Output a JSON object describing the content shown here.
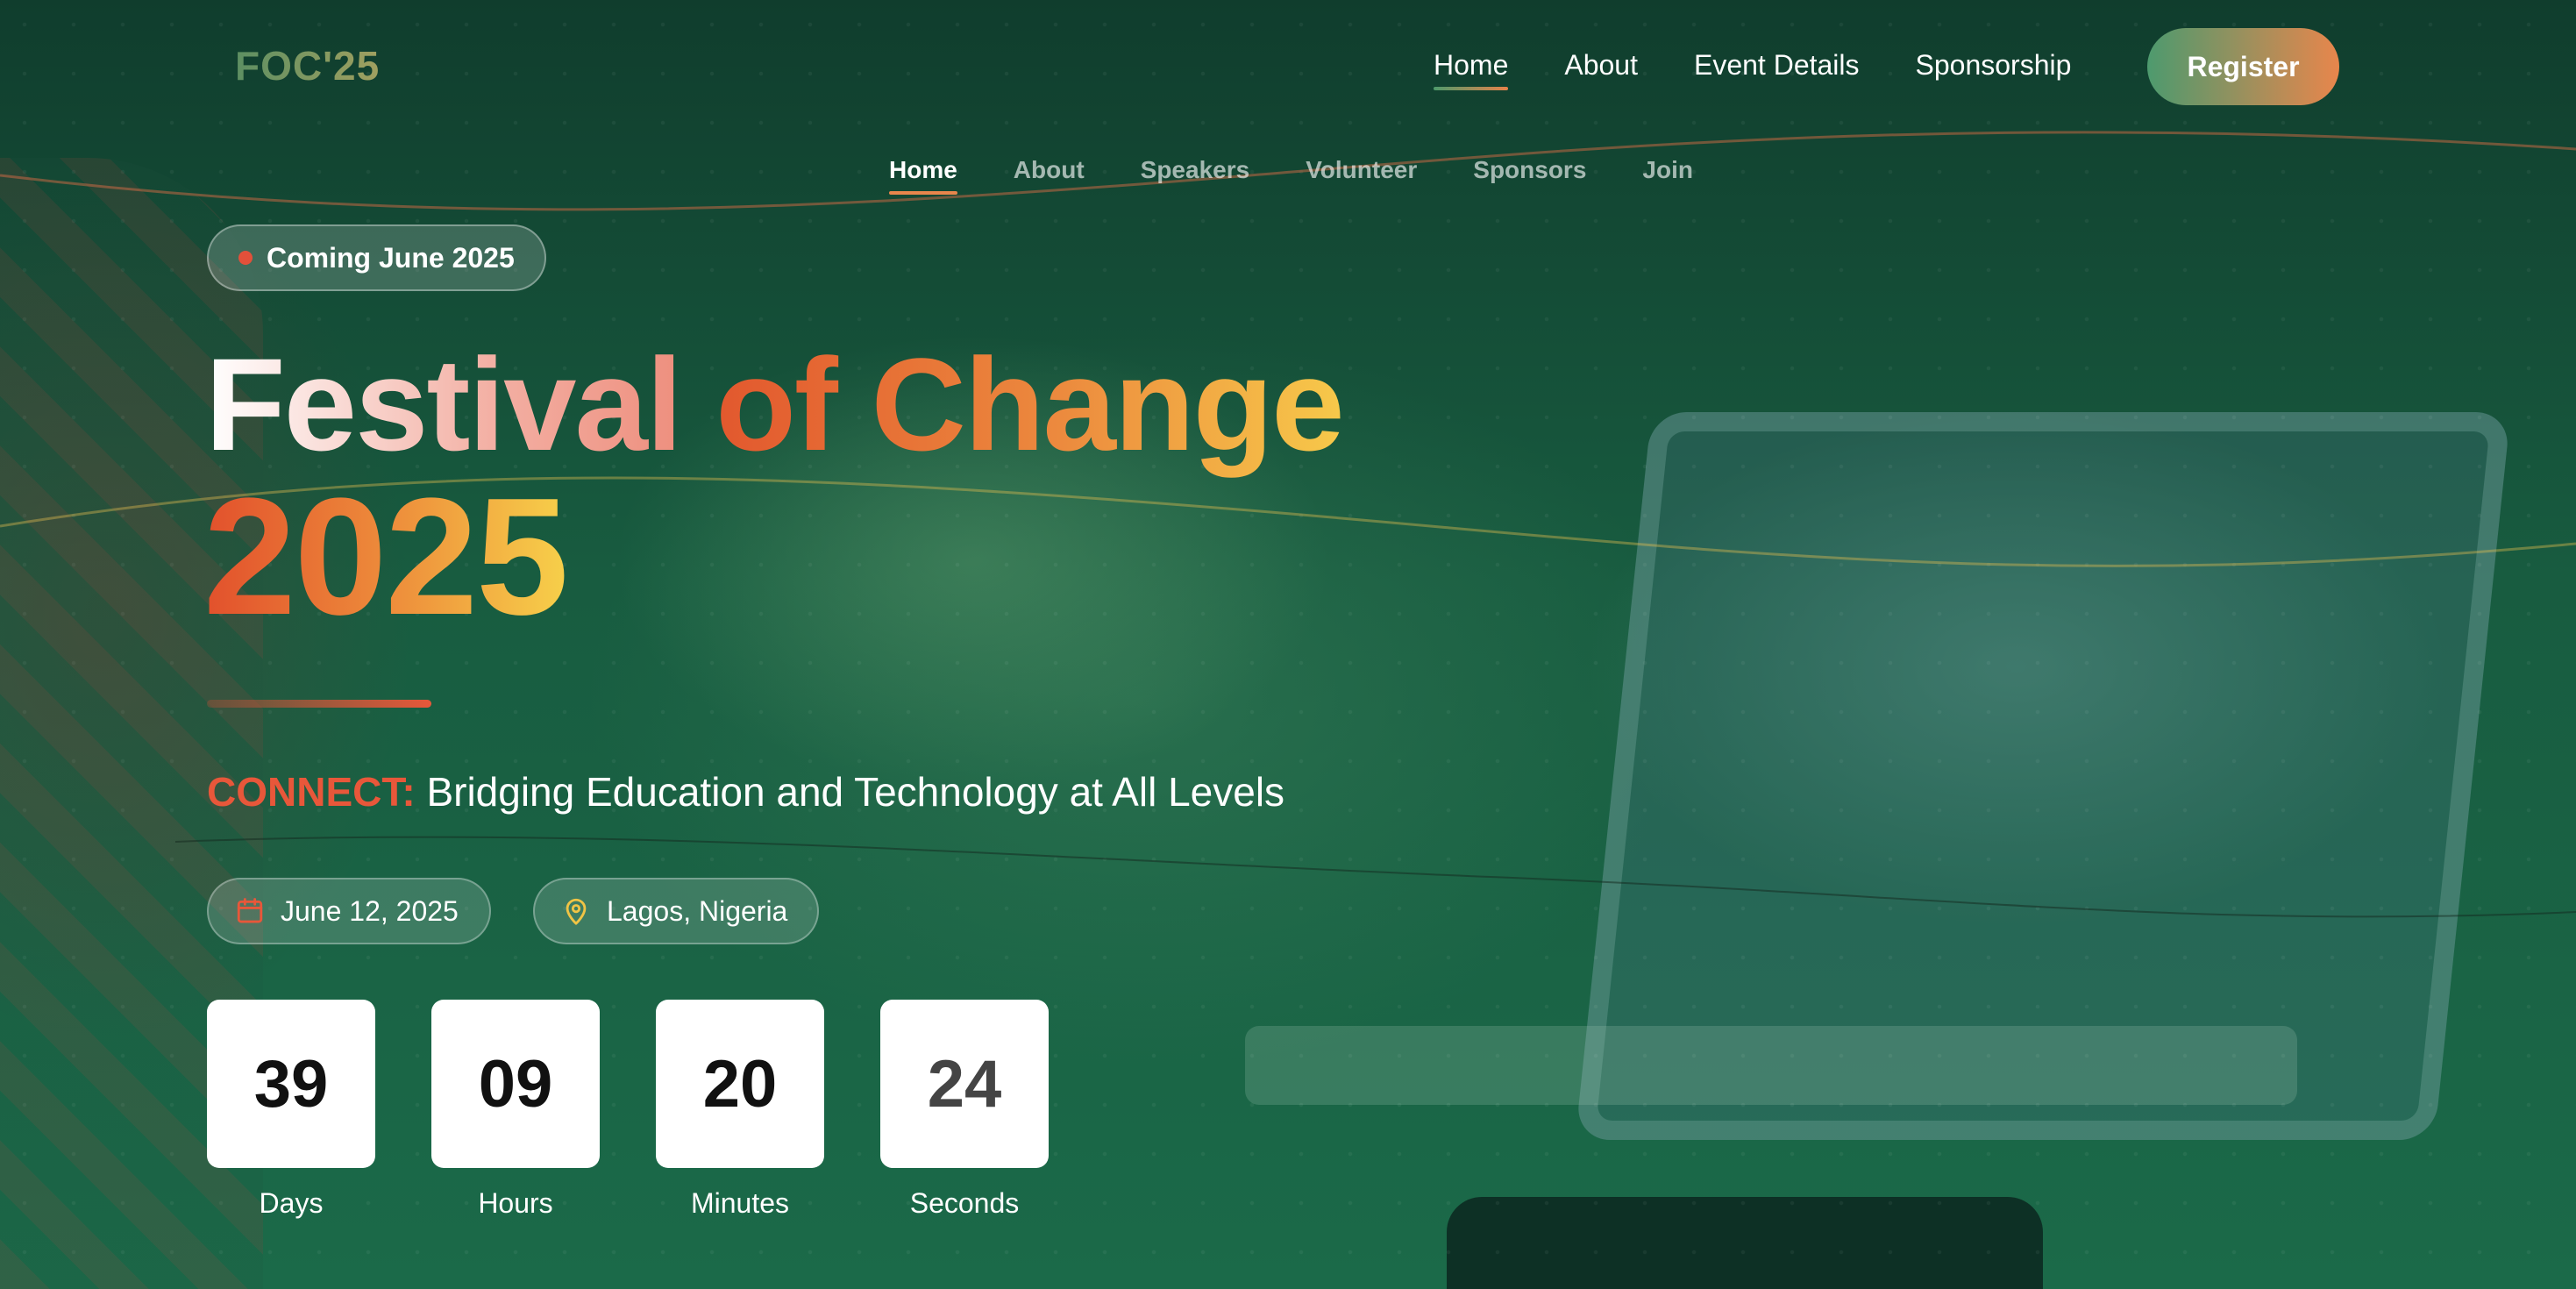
{
  "header": {
    "logo": "FOC'25",
    "main_nav": [
      {
        "label": "Home",
        "active": true
      },
      {
        "label": "About",
        "active": false
      },
      {
        "label": "Event Details",
        "active": false
      },
      {
        "label": "Sponsorship",
        "active": false
      }
    ],
    "register_label": "Register",
    "sub_nav": [
      {
        "label": "Home",
        "active": true
      },
      {
        "label": "About",
        "active": false
      },
      {
        "label": "Speakers",
        "active": false
      },
      {
        "label": "Volunteer",
        "active": false
      },
      {
        "label": "Sponsors",
        "active": false
      },
      {
        "label": "Join",
        "active": false
      }
    ]
  },
  "hero": {
    "badge": "Coming June 2025",
    "title_part_a": "Festival",
    "title_part_b": "of Change",
    "title_year": "2025",
    "tagline_keyword": "CONNECT:",
    "tagline_text": "Bridging Education and Technology at All Levels",
    "date": {
      "icon": "calendar-icon",
      "text": "June 12, 2025"
    },
    "location": {
      "icon": "map-pin-icon",
      "text": "Lagos, Nigeria"
    },
    "countdown": [
      {
        "value": "39",
        "label": "Days"
      },
      {
        "value": "09",
        "label": "Hours"
      },
      {
        "value": "20",
        "label": "Minutes"
      },
      {
        "value": "24",
        "label": "Seconds"
      }
    ]
  },
  "colors": {
    "background": "#185c40",
    "accent_orange": "#e8573a",
    "accent_yellow": "#f7c94a",
    "accent_green": "#4d9a6e"
  }
}
